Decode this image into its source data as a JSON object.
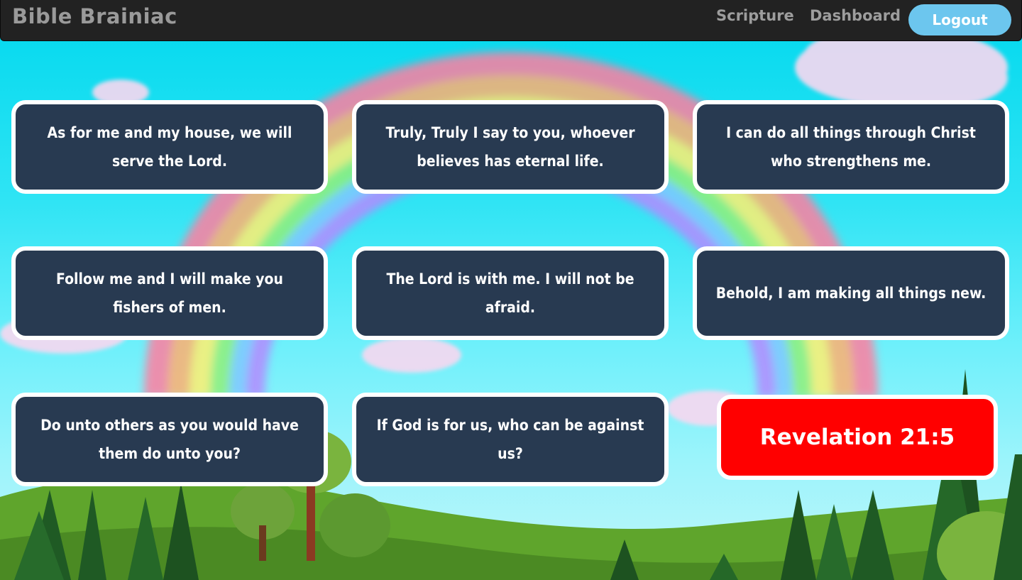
{
  "navbar": {
    "brand": "Bible Brainiac",
    "links": [
      "Scripture",
      "Dashboard"
    ],
    "logout_label": "Logout"
  },
  "cards": [
    "As for me and my house, we will serve the Lord.",
    "Truly, Truly I say to you, whoever believes has eternal life.",
    "I can do all things through Christ who strengthens me.",
    "Follow me and I will make you fishers of men.",
    "The Lord is with me. I will not be afraid.",
    "Behold, I am making all things new.",
    "Do unto others as you would have them do unto you?",
    "If God is for us, who can be against us?"
  ],
  "answer": {
    "reference": "Revelation 21:5",
    "color": "#ff0000"
  },
  "colors": {
    "card_bg": "#283a51",
    "navbar_bg": "#222222",
    "logout_bg": "#6cc6ee"
  }
}
